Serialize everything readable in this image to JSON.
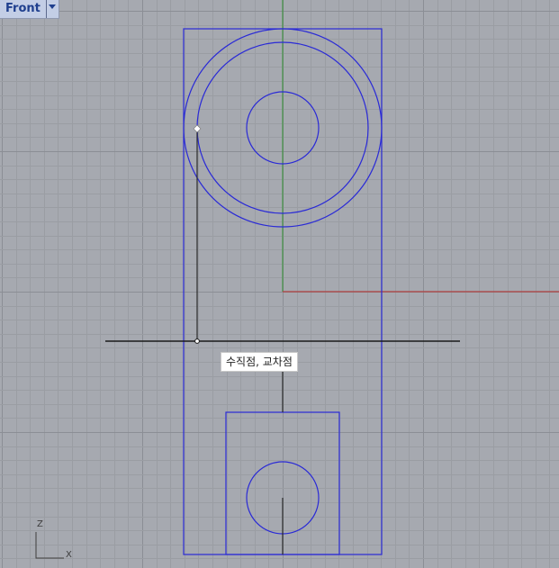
{
  "viewport": {
    "title": "Front",
    "tooltip": "수직점, 교차점",
    "axis_labels": {
      "vertical": "Z",
      "horizontal": "X"
    }
  },
  "colors": {
    "background": "#a6a9b0",
    "grid_minor": "#9a9da3",
    "grid_major": "#8b8e95",
    "geometry": "#2a2ad6",
    "construction_line": "#1a1a1a",
    "axis_x": "#b04040",
    "axis_z": "#2f8f2f"
  }
}
